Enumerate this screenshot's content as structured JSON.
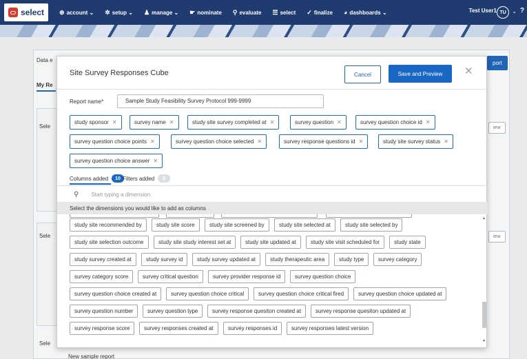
{
  "nav": {
    "logo": "select",
    "items": [
      {
        "icon": "globe",
        "label": "account ⌄"
      },
      {
        "icon": "gear",
        "label": "setup ⌄"
      },
      {
        "icon": "person",
        "label": "manage ⌄"
      },
      {
        "icon": "nominate",
        "label": "nominate"
      },
      {
        "icon": "search",
        "label": "evaluate"
      },
      {
        "icon": "list",
        "label": "select"
      },
      {
        "icon": "check",
        "label": "finalize"
      },
      {
        "icon": "pie",
        "label": "dashboards ⌄"
      }
    ],
    "user": "Test User1",
    "avatar": "TU",
    "avatar_chevron": "⌄",
    "help": "?"
  },
  "background": {
    "tab_data": "Data e",
    "tab_my": "My Re",
    "sel1": "Sele",
    "sel2": "Sele",
    "sel3": "Sele",
    "report_btn": "port",
    "view1": "iew",
    "view2": "iew",
    "sample": "New sample report"
  },
  "modal": {
    "title": "Site Survey Responses Cube",
    "cancel": "Cancel",
    "save": "Save and Preview",
    "close": "✕",
    "report_name_label": "Report name*",
    "report_name_value": "Sample Study Feasibility Survey Protocol 999-9999",
    "chips": [
      "study sponsor",
      "survey name",
      "study site survey completed at",
      "survey question",
      "survey question choice id",
      "survey question choice points",
      "survey question choice selected",
      "survey response questions id",
      "study site survey status",
      "survey question choice answer"
    ],
    "tabs": {
      "columns_label": "Columns added",
      "columns_count": "10",
      "filters_label": "Filters added",
      "filters_count": "0"
    },
    "search_placeholder": "Start typing a dimension",
    "hint": "Select the dimensions you would like to add as columns",
    "dimensions": [
      "study site recommended by",
      "study site score",
      "study site screened by",
      "study site selected at",
      "study site selected by",
      "study site selection outcome",
      "study site study interest set at",
      "study site updated at",
      "study site visit scheduled for",
      "study state",
      "study survey created at",
      "study survey id",
      "study survey updated at",
      "study therapeutic area",
      "study type",
      "survey category",
      "survey category score",
      "survey critical question",
      "survey provider response id",
      "survey question choice",
      "survey question choice created at",
      "survey question choice critical",
      "survey question choice critical fired",
      "survey question choice updated at",
      "survey question number",
      "survey question type",
      "survey response quesiton created at",
      "survey response quesiton updated at",
      "survey response score",
      "survey responses created at",
      "survey responses id",
      "survey responses latest version"
    ]
  }
}
